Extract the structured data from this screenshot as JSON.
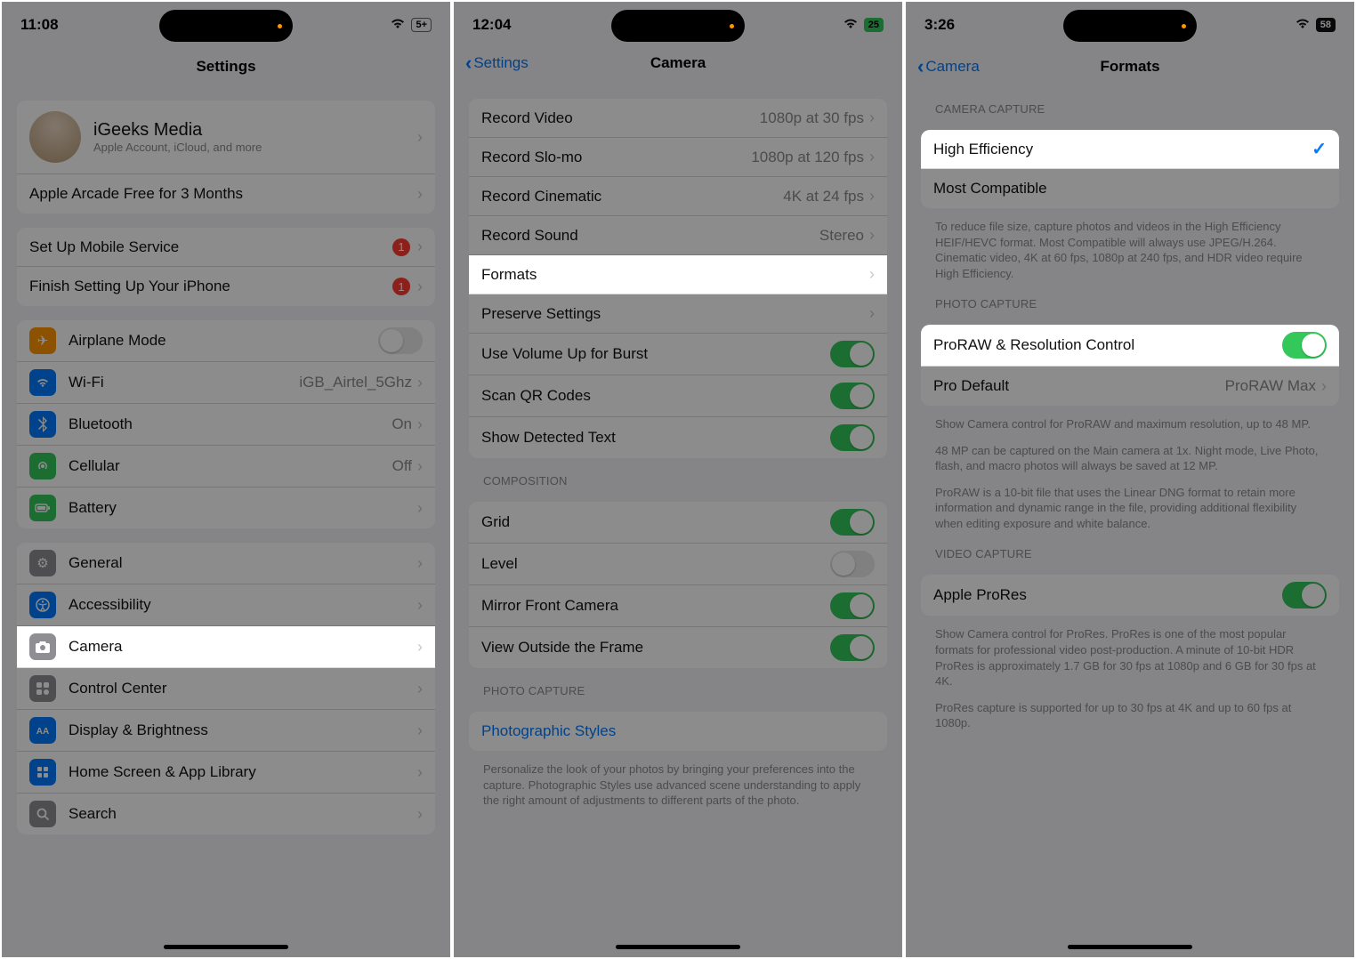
{
  "screens": {
    "s1": {
      "time": "11:08",
      "battery": "5+",
      "title": "Settings",
      "profile": {
        "name": "iGeeks Media",
        "sub": "Apple Account, iCloud, and more"
      },
      "arcade": "Apple Arcade Free for 3 Months",
      "setup_mobile": "Set Up Mobile Service",
      "finish_setup": "Finish Setting Up Your iPhone",
      "badge1": "1",
      "badge2": "1",
      "airplane": "Airplane Mode",
      "wifi": "Wi-Fi",
      "wifi_val": "iGB_Airtel_5Ghz",
      "bluetooth": "Bluetooth",
      "bluetooth_val": "On",
      "cellular": "Cellular",
      "cellular_val": "Off",
      "battery_row": "Battery",
      "general": "General",
      "accessibility": "Accessibility",
      "camera": "Camera",
      "control_center": "Control Center",
      "display": "Display & Brightness",
      "home_screen": "Home Screen & App Library",
      "search": "Search"
    },
    "s2": {
      "time": "12:04",
      "battery": "25",
      "back": "Settings",
      "title": "Camera",
      "record_video": "Record Video",
      "record_video_val": "1080p at 30 fps",
      "record_slomo": "Record Slo-mo",
      "record_slomo_val": "1080p at 120 fps",
      "record_cinematic": "Record Cinematic",
      "record_cinematic_val": "4K at 24 fps",
      "record_sound": "Record Sound",
      "record_sound_val": "Stereo",
      "formats": "Formats",
      "preserve": "Preserve Settings",
      "vol_burst": "Use Volume Up for Burst",
      "scan_qr": "Scan QR Codes",
      "detected_text": "Show Detected Text",
      "composition_hdr": "COMPOSITION",
      "grid": "Grid",
      "level": "Level",
      "mirror": "Mirror Front Camera",
      "view_outside": "View Outside the Frame",
      "photo_capture_hdr": "PHOTO CAPTURE",
      "photo_styles": "Photographic Styles",
      "photo_styles_footer": "Personalize the look of your photos by bringing your preferences into the capture. Photographic Styles use advanced scene understanding to apply the right amount of adjustments to different parts of the photo."
    },
    "s3": {
      "time": "3:26",
      "battery": "58",
      "back": "Camera",
      "title": "Formats",
      "cam_capture_hdr": "CAMERA CAPTURE",
      "high_eff": "High Efficiency",
      "most_compat": "Most Compatible",
      "cam_footer": "To reduce file size, capture photos and videos in the High Efficiency HEIF/HEVC format. Most Compatible will always use JPEG/H.264. Cinematic video, 4K at 60 fps, 1080p at 240 fps, and HDR video require High Efficiency.",
      "photo_capture_hdr": "PHOTO CAPTURE",
      "proraw": "ProRAW & Resolution Control",
      "pro_default": "Pro Default",
      "pro_default_val": "ProRAW Max",
      "proraw_f1": "Show Camera control for ProRAW and maximum resolution, up to 48 MP.",
      "proraw_f2": "48 MP can be captured on the Main camera at 1x. Night mode, Live Photo, flash, and macro photos will always be saved at 12 MP.",
      "proraw_f3": "ProRAW is a 10-bit file that uses the Linear DNG format to retain more information and dynamic range in the file, providing additional flexibility when editing exposure and white balance.",
      "video_capture_hdr": "VIDEO CAPTURE",
      "prores": "Apple ProRes",
      "prores_f1": "Show Camera control for ProRes. ProRes is one of the most popular formats for professional video post-production. A minute of 10-bit HDR ProRes is approximately 1.7 GB for 30 fps at 1080p and 6 GB for 30 fps at 4K.",
      "prores_f2": "ProRes capture is supported for up to 30 fps at 4K and up to 60 fps at 1080p."
    }
  }
}
